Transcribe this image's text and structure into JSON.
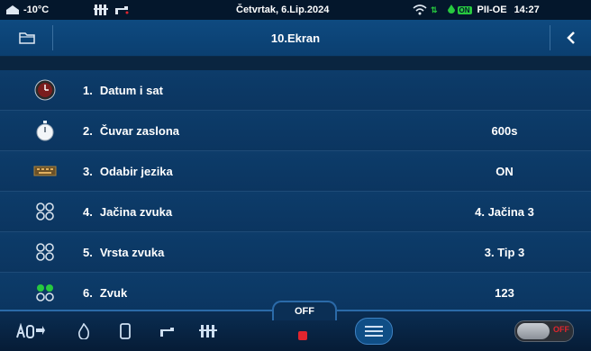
{
  "status_bar": {
    "temperature": "-10°C",
    "date": "Četvrtak, 6.Lip.2024",
    "mode_label": "PII-OE",
    "on_badge": "ON",
    "time": "14:27"
  },
  "header": {
    "title": "10.Ekran"
  },
  "settings": [
    {
      "number": "1.",
      "label": "Datum i sat",
      "value": "",
      "icon": "clock-icon"
    },
    {
      "number": "2.",
      "label": "Čuvar zaslona",
      "value": "600s",
      "icon": "stopwatch-icon"
    },
    {
      "number": "3.",
      "label": "Odabir jezika",
      "value": "ON",
      "icon": "keyboard-icon"
    },
    {
      "number": "4.",
      "label": "Jačina zvuka",
      "value": "4. Jačina 3",
      "icon": "dots-icon"
    },
    {
      "number": "5.",
      "label": "Vrsta zvuka",
      "value": "3. Tip 3",
      "icon": "dots-icon"
    },
    {
      "number": "6.",
      "label": "Zvuk",
      "value": "123",
      "icon": "dots-icon"
    }
  ],
  "bottom_bar": {
    "off_label": "OFF",
    "toggle_label": "OFF"
  },
  "colors": {
    "background": "#0a2540",
    "row": "#0b3560",
    "header": "#0e4a80",
    "accent": "#2b6aa8",
    "status_green": "#27c93f",
    "alert_red": "#e0252e"
  }
}
